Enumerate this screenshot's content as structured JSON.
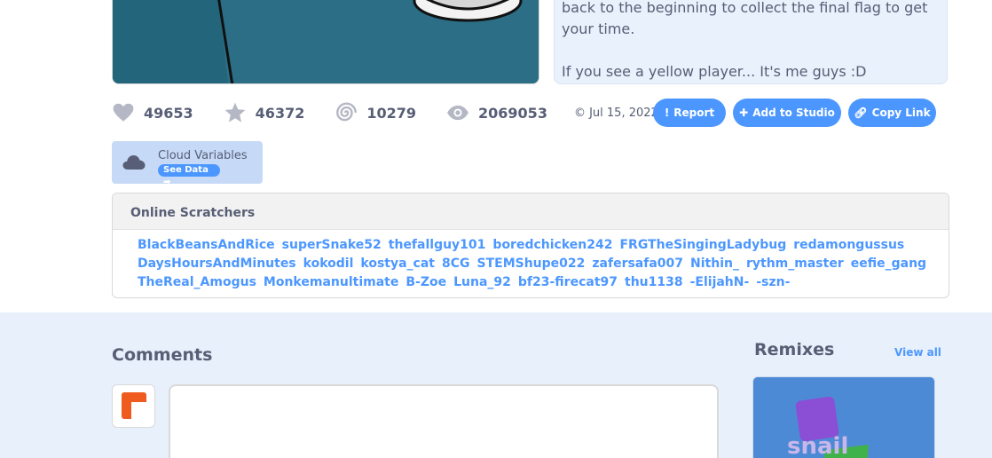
{
  "notes": {
    "line1": "back to the beginning to collect the final flag to get",
    "line2": "your time.",
    "line3": "If you see a yellow player... It's me guys :D"
  },
  "stats": {
    "loves": "49653",
    "favorites": "46372",
    "remixes": "10279",
    "views": "2069053",
    "date": "Jul 15, 2022"
  },
  "buttons": {
    "report": "Report",
    "add_to_studio": "Add to Studio",
    "copy_link": "Copy Link"
  },
  "cloud": {
    "title": "Cloud Variables",
    "see_data": "See Data"
  },
  "online": {
    "heading": "Online Scratchers",
    "users": [
      "BlackBeansAndRice",
      "superSnake52",
      "thefallguy101",
      "boredchicken242",
      "FRGTheSingingLadybug",
      "redamongussus",
      "DaysHoursAndMinutes",
      "kokodil",
      "kostya_cat",
      "8CG",
      "STEMShupe022",
      "zafersafa007",
      "Nithin_",
      "rythm_master",
      "eefie_gang",
      "TheReal_Amogus",
      "Monkemanultimate",
      "B-Zoe",
      "Luna_92",
      "bf23-firecat97",
      "thu1138",
      "-ElijahN-",
      "-szn-"
    ]
  },
  "comments": {
    "title": "Comments"
  },
  "remixes": {
    "title": "Remixes",
    "view_all": "View all",
    "thumb_text": "snail"
  },
  "colors": {
    "accent": "#4c97ff",
    "text": "#575e75",
    "lower_bg": "#e8f0fc"
  }
}
